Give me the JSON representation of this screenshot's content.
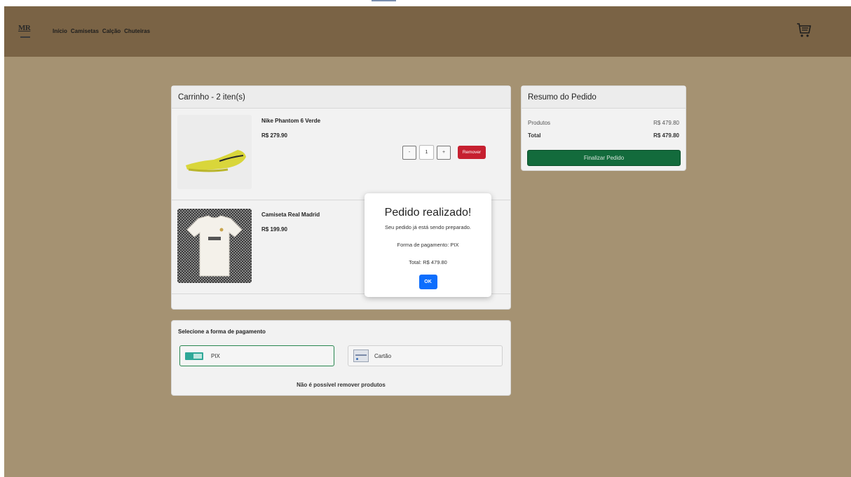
{
  "navbar": {
    "logo_text": "MR",
    "links": [
      "Início",
      "Camisetas",
      "Calção",
      "Chuteiras"
    ],
    "cart_icon": "shopping-cart-icon"
  },
  "cart": {
    "title": "Carrinho - 2 iten(s)",
    "items": [
      {
        "name": "Nike Phantom 6 Verde",
        "price": "R$ 279.90",
        "quantity": "1",
        "minus": "-",
        "plus": "+",
        "remove_label": "Remover"
      },
      {
        "name": "Camiseta Real Madrid",
        "price": "R$ 199.90"
      }
    ]
  },
  "summary": {
    "title": "Resumo do Pedido",
    "products_label": "Produtos",
    "products_value": "R$ 479.80",
    "total_label": "Total",
    "total_value": "R$ 479.80",
    "finish_label": "Finalizar Pedido"
  },
  "payment": {
    "title": "Selecione a forma de pagamento",
    "pix_label": "PIX",
    "card_label": "Cartão",
    "note": "Não é possível remover produtos"
  },
  "modal": {
    "title": "Pedido realizado!",
    "message": "Seu pedido já está sendo preparado.",
    "payment_line": "Forma de pagamento: PIX",
    "total_line": "Total: R$ 479.80",
    "ok_label": "OK"
  },
  "colors": {
    "navbar": "#7a6345",
    "background": "#a59272",
    "finish_button": "#136b3c",
    "remove_button": "#c62030",
    "ok_button": "#0d6efd"
  }
}
